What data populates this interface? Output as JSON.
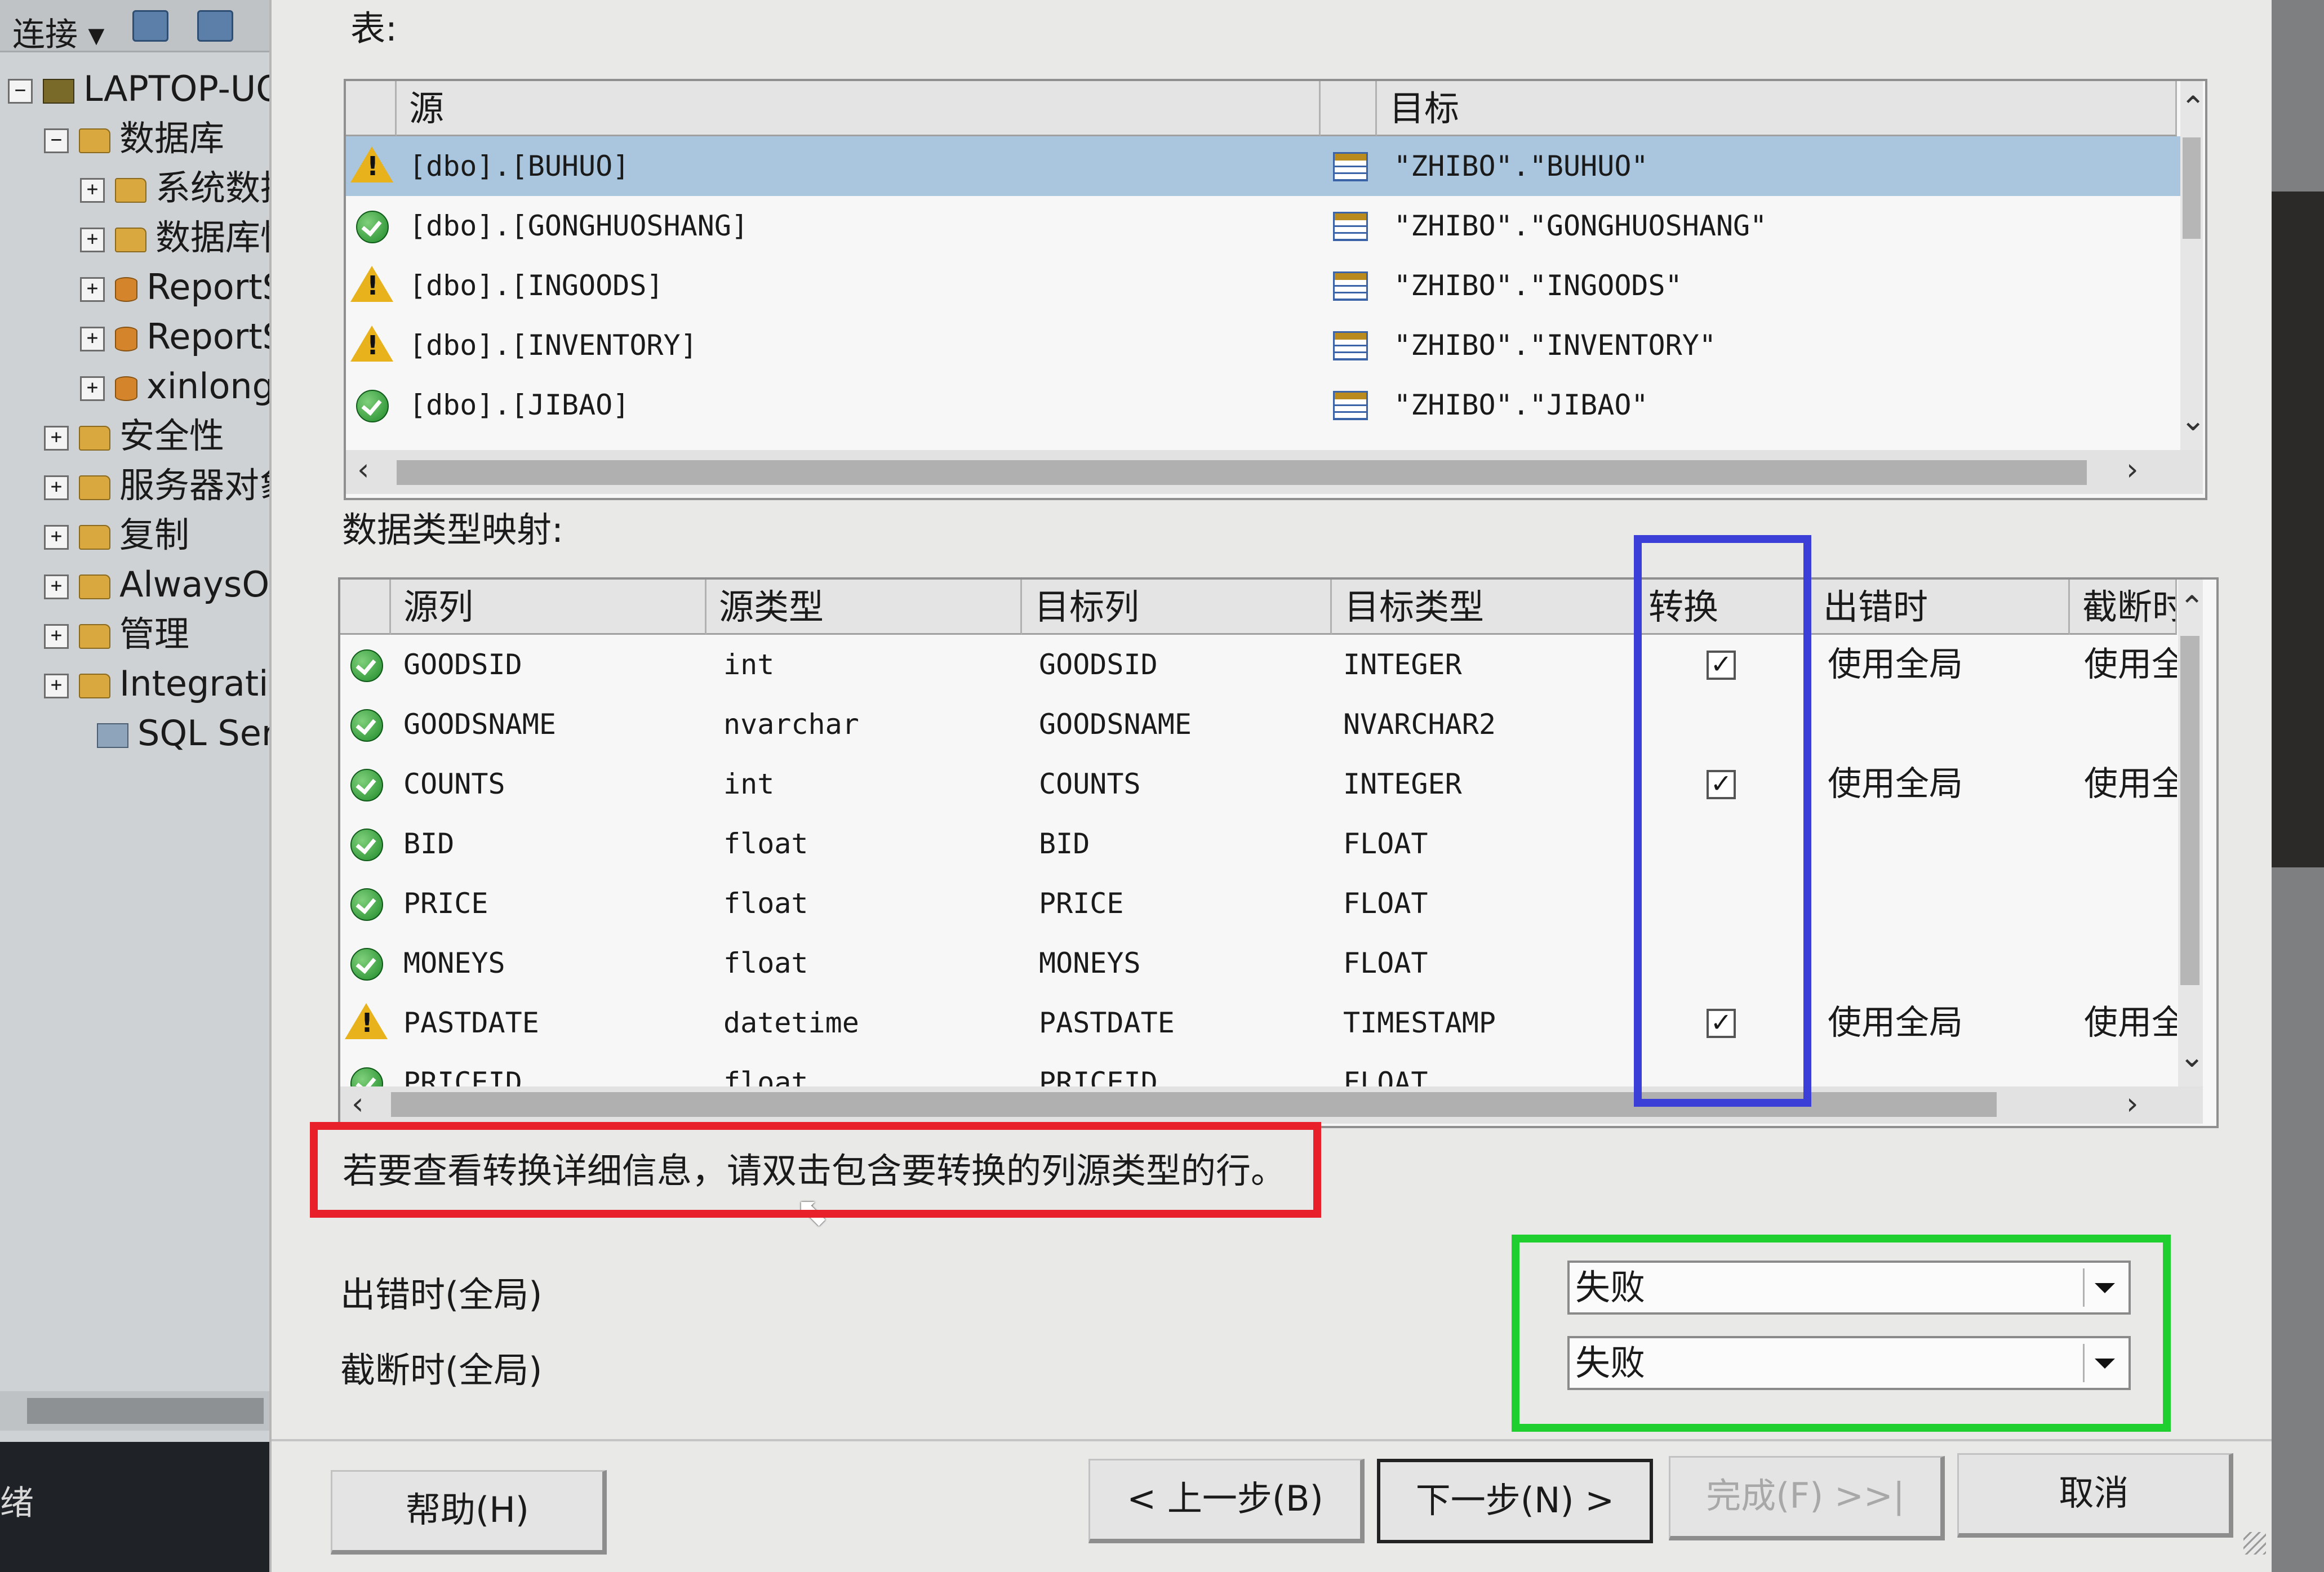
{
  "left_panel": {
    "toolbar_label": "连接 ▾",
    "tree": [
      {
        "label": "LAPTOP-UO",
        "expander": "⊟",
        "icon": "server-icon"
      },
      {
        "label": "数据库",
        "expander": "⊟",
        "icon": "folder-icon"
      },
      {
        "label": "系统数据",
        "expander": "⊞",
        "icon": "folder-icon"
      },
      {
        "label": "数据库快",
        "expander": "⊞",
        "icon": "folder-icon"
      },
      {
        "label": "ReportS",
        "expander": "⊞",
        "icon": "database-icon"
      },
      {
        "label": "ReportS",
        "expander": "⊞",
        "icon": "database-icon"
      },
      {
        "label": "xinlong",
        "expander": "⊞",
        "icon": "database-icon"
      },
      {
        "label": "安全性",
        "expander": "⊞",
        "icon": "folder-icon"
      },
      {
        "label": "服务器对象",
        "expander": "⊞",
        "icon": "folder-icon"
      },
      {
        "label": "复制",
        "expander": "⊞",
        "icon": "folder-icon"
      },
      {
        "label": "AlwaysOn",
        "expander": "⊞",
        "icon": "folder-icon"
      },
      {
        "label": "管理",
        "expander": "⊞",
        "icon": "folder-icon"
      },
      {
        "label": "Integratior",
        "expander": "⊞",
        "icon": "folder-icon"
      },
      {
        "label": "SQL Serve",
        "expander": "",
        "icon": "sql-agent-icon"
      }
    ],
    "status_text": "绪"
  },
  "dialog": {
    "tables_label": "表:",
    "tables_grid": {
      "headers": {
        "source": "源",
        "target": "目标"
      },
      "rows": [
        {
          "status": "warning",
          "source": "[dbo].[BUHUO]",
          "target": "\"ZHIBO\".\"BUHUO\"",
          "selected": true
        },
        {
          "status": "ok",
          "source": "[dbo].[GONGHUOSHANG]",
          "target": "\"ZHIBO\".\"GONGHUOSHANG\"",
          "selected": false
        },
        {
          "status": "warning",
          "source": "[dbo].[INGOODS]",
          "target": "\"ZHIBO\".\"INGOODS\"",
          "selected": false
        },
        {
          "status": "warning",
          "source": "[dbo].[INVENTORY]",
          "target": "\"ZHIBO\".\"INVENTORY\"",
          "selected": false
        },
        {
          "status": "ok",
          "source": "[dbo].[JIBAO]",
          "target": "\"ZHIBO\".\"JIBAO\"",
          "selected": false
        }
      ]
    },
    "mapping_label": "数据类型映射:",
    "mapping_grid": {
      "headers": {
        "src_col": "源列",
        "src_type": "源类型",
        "dst_col": "目标列",
        "dst_type": "目标类型",
        "convert": "转换",
        "on_error": "出错时",
        "on_trunc": "截断时"
      },
      "rows": [
        {
          "status": "ok",
          "src_col": "GOODSID",
          "src_type": "int",
          "dst_col": "GOODSID",
          "dst_type": "INTEGER",
          "convert": true,
          "on_error": "使用全局",
          "on_trunc": "使用全"
        },
        {
          "status": "ok",
          "src_col": "GOODSNAME",
          "src_type": "nvarchar",
          "dst_col": "GOODSNAME",
          "dst_type": "NVARCHAR2",
          "convert": false,
          "on_error": "",
          "on_trunc": ""
        },
        {
          "status": "ok",
          "src_col": "COUNTS",
          "src_type": "int",
          "dst_col": "COUNTS",
          "dst_type": "INTEGER",
          "convert": true,
          "on_error": "使用全局",
          "on_trunc": "使用全"
        },
        {
          "status": "ok",
          "src_col": "BID",
          "src_type": "float",
          "dst_col": "BID",
          "dst_type": "FLOAT",
          "convert": false,
          "on_error": "",
          "on_trunc": ""
        },
        {
          "status": "ok",
          "src_col": "PRICE",
          "src_type": "float",
          "dst_col": "PRICE",
          "dst_type": "FLOAT",
          "convert": false,
          "on_error": "",
          "on_trunc": ""
        },
        {
          "status": "ok",
          "src_col": "MONEYS",
          "src_type": "float",
          "dst_col": "MONEYS",
          "dst_type": "FLOAT",
          "convert": false,
          "on_error": "",
          "on_trunc": ""
        },
        {
          "status": "warning",
          "src_col": "PASTDATE",
          "src_type": "datetime",
          "dst_col": "PASTDATE",
          "dst_type": "TIMESTAMP",
          "convert": true,
          "on_error": "使用全局",
          "on_trunc": "使用全"
        },
        {
          "status": "ok",
          "src_col": "PRICEID",
          "src_type": "float",
          "dst_col": "PRICEID",
          "dst_type": "FLOAT",
          "convert": false,
          "on_error": "",
          "on_trunc": ""
        }
      ]
    },
    "hint_text": "若要查看转换详细信息，请双击包含要转换的列源类型的行。",
    "on_error_global": {
      "label": "出错时(全局)",
      "value": "失败"
    },
    "on_trunc_global": {
      "label": "截断时(全局)",
      "value": "失败"
    },
    "buttons": {
      "help": "帮助(H)",
      "back": "< 上一步(B)",
      "next": "下一步(N) >",
      "finish": "完成(F) >>|",
      "cancel": "取消"
    }
  },
  "annotation_colors": {
    "blue": "#3b3fd8",
    "red": "#e8202a",
    "green": "#1fcf2f"
  }
}
